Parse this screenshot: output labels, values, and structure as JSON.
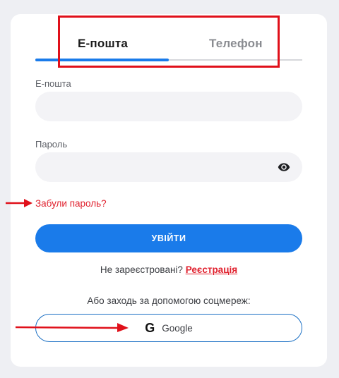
{
  "tabs": {
    "email_label": "Е-пошта",
    "phone_label": "Телефон"
  },
  "form": {
    "email_label": "Е-пошта",
    "email_value": "",
    "password_label": "Пароль",
    "password_value": "",
    "forgot_label": "Забули пароль?",
    "login_label": "УВІЙТИ"
  },
  "register": {
    "prompt": "Не зареєстровані? ",
    "link_label": "Реєстрація"
  },
  "social": {
    "label": "Або заходь за допомогою соцмереж:",
    "google_icon": "G",
    "google_label": "Google"
  },
  "colors": {
    "accent": "#1a7bea",
    "link_red": "#e0212e",
    "annotation_red": "#e0101a"
  },
  "icons": [
    "eye-icon",
    "google-icon",
    "arrow-icon"
  ]
}
